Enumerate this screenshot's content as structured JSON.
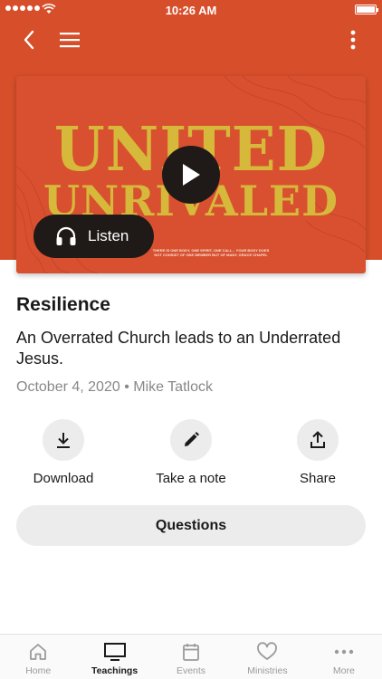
{
  "status_bar": {
    "time": "10:26 AM"
  },
  "colors": {
    "header": "#d64f2a",
    "art_text": "#d6b93a",
    "dark": "#1f1a18",
    "muted": "#888888"
  },
  "nav": {
    "back_icon": "chevron-left-icon",
    "menu_icon": "hamburger-icon",
    "more_icon": "vertical-dots-icon"
  },
  "artwork": {
    "line1": "UNITED",
    "line2": "UNRIVALED",
    "caption": "THERE IS ONE BODY, ONE SPIRIT, ONE CALL... YOUR BODY DOES NOT CONSIST OF ONE MEMBER BUT OF MANY. GRACE CHAPEL"
  },
  "listen_label": "Listen",
  "teaching": {
    "title": "Resilience",
    "subtitle": "An Overrated Church leads to an Underrated Jesus.",
    "meta": "October 4, 2020 • Mike Tatlock"
  },
  "actions": {
    "download": "Download",
    "note": "Take a note",
    "share": "Share"
  },
  "questions_label": "Questions",
  "tabs": [
    {
      "label": "Home",
      "icon": "home-icon"
    },
    {
      "label": "Teachings",
      "icon": "tv-icon"
    },
    {
      "label": "Events",
      "icon": "calendar-icon"
    },
    {
      "label": "Ministries",
      "icon": "heart-icon"
    },
    {
      "label": "More",
      "icon": "more-dots-icon"
    }
  ]
}
